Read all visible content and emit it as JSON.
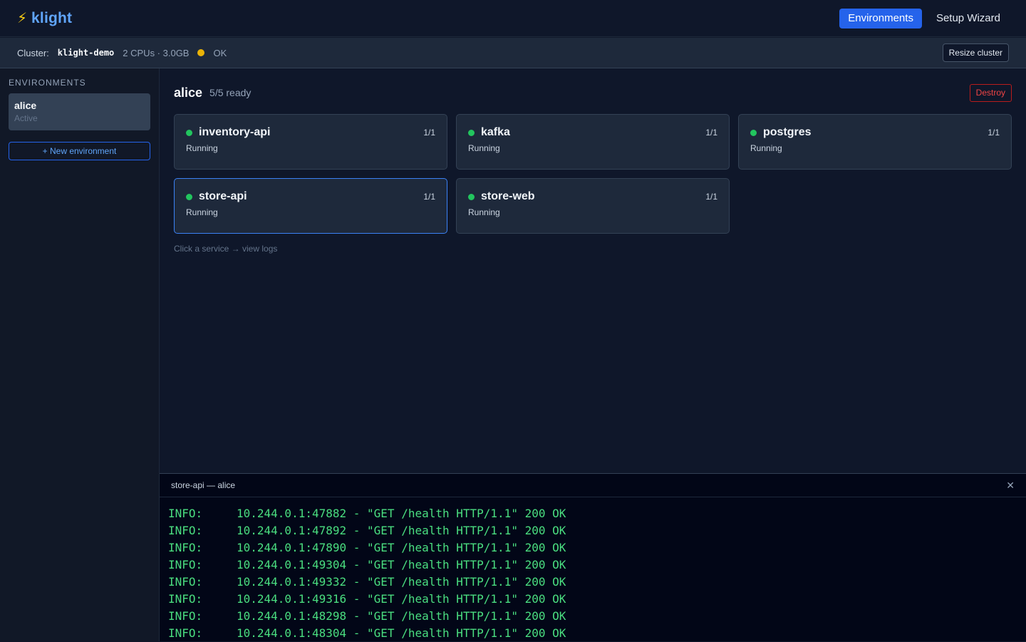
{
  "brand": {
    "icon": "lightning-bolt-icon",
    "name": "klight"
  },
  "nav": {
    "environments": "Environments",
    "setup_wizard": "Setup Wizard"
  },
  "cluster": {
    "label": "Cluster:",
    "name": "klight-demo",
    "resources": "2 CPUs · 3.0GB",
    "status_color": "#eab308",
    "status": "OK",
    "resize_label": "Resize cluster"
  },
  "sidebar": {
    "heading": "ENVIRONMENTS",
    "items": [
      {
        "name": "alice",
        "status": "Active"
      }
    ],
    "new_env_label": "+ New environment"
  },
  "environment": {
    "name": "alice",
    "ready": "5/5 ready",
    "destroy_label": "Destroy",
    "services": [
      {
        "name": "inventory-api",
        "count": "1/1",
        "state": "Running"
      },
      {
        "name": "kafka",
        "count": "1/1",
        "state": "Running"
      },
      {
        "name": "postgres",
        "count": "1/1",
        "state": "Running"
      },
      {
        "name": "store-api",
        "count": "1/1",
        "state": "Running"
      },
      {
        "name": "store-web",
        "count": "1/1",
        "state": "Running"
      }
    ],
    "hint": "Click a service → view logs"
  },
  "logs": {
    "title": "store-api — alice",
    "close_icon": "close-icon",
    "lines": [
      {
        "level": "INFO:",
        "message": "10.244.0.1:47882 - \"GET /health HTTP/1.1\" 200 OK"
      },
      {
        "level": "INFO:",
        "message": "10.244.0.1:47892 - \"GET /health HTTP/1.1\" 200 OK"
      },
      {
        "level": "INFO:",
        "message": "10.244.0.1:47890 - \"GET /health HTTP/1.1\" 200 OK"
      },
      {
        "level": "INFO:",
        "message": "10.244.0.1:49304 - \"GET /health HTTP/1.1\" 200 OK"
      },
      {
        "level": "INFO:",
        "message": "10.244.0.1:49332 - \"GET /health HTTP/1.1\" 200 OK"
      },
      {
        "level": "INFO:",
        "message": "10.244.0.1:49316 - \"GET /health HTTP/1.1\" 200 OK"
      },
      {
        "level": "INFO:",
        "message": "10.244.0.1:48298 - \"GET /health HTTP/1.1\" 200 OK"
      },
      {
        "level": "INFO:",
        "message": "10.244.0.1:48304 - \"GET /health HTTP/1.1\" 200 OK"
      }
    ]
  }
}
